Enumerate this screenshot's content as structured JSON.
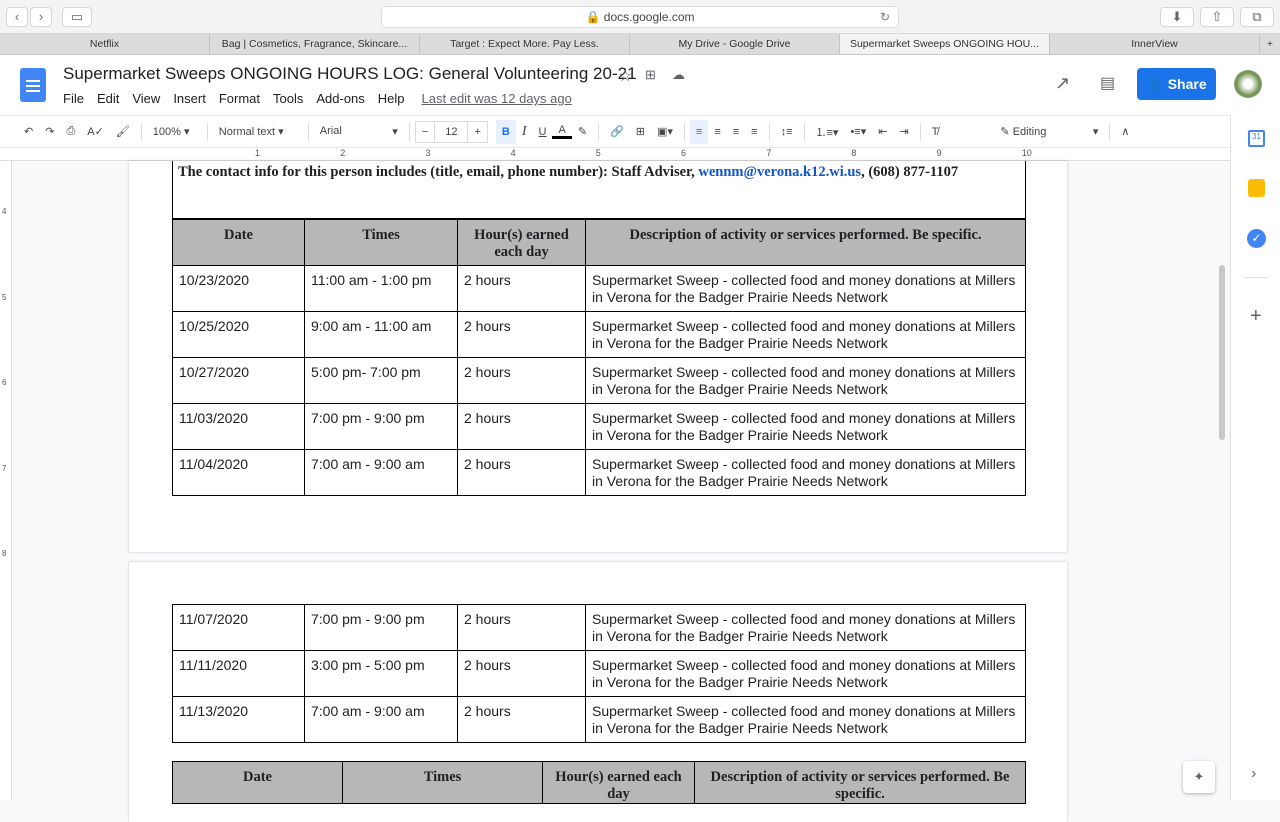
{
  "browser": {
    "url": "docs.google.com",
    "tabs": [
      "Netflix",
      "Bag | Cosmetics, Fragrance, Skincare...",
      "Target : Expect More. Pay Less.",
      "My Drive - Google Drive",
      "Supermarket Sweeps ONGOING HOU...",
      "InnerView"
    ],
    "active_tab": 4
  },
  "doc": {
    "title": "Supermarket Sweeps ONGOING HOURS LOG: General Volunteering 20-21",
    "menu": [
      "File",
      "Edit",
      "View",
      "Insert",
      "Format",
      "Tools",
      "Add-ons",
      "Help"
    ],
    "last_edit": "Last edit was 12 days ago",
    "share": "Share"
  },
  "toolbar": {
    "zoom": "100%",
    "style": "Normal text",
    "font": "Arial",
    "size": "12",
    "mode": "Editing"
  },
  "ruler": [
    "1",
    "2",
    "3",
    "4",
    "5",
    "6",
    "7",
    "8",
    "9",
    "10"
  ],
  "vruler": [
    "4",
    "5",
    "6",
    "7",
    "8"
  ],
  "contact": {
    "prefix": "The contact info for this person includes (title, email, phone number):  Staff Adviser, ",
    "email": "wennm@verona.k12.wi.us",
    "suffix": ", (608) 877-1107"
  },
  "headers": [
    "Date",
    "Times",
    "Hour(s) earned each day",
    "Description of activity or services performed. Be specific."
  ],
  "rows_page1": [
    [
      "10/23/2020",
      "11:00 am - 1:00 pm",
      "2 hours",
      "Supermarket Sweep - collected food and money donations at Millers in Verona for the Badger Prairie Needs Network"
    ],
    [
      "10/25/2020",
      "9:00 am - 11:00 am",
      "2 hours",
      "Supermarket Sweep - collected food and money donations at Millers in Verona for the Badger Prairie Needs Network"
    ],
    [
      "10/27/2020",
      "5:00 pm- 7:00 pm",
      "2 hours",
      "Supermarket Sweep - collected food and money donations at Millers in Verona for the Badger Prairie Needs Network"
    ],
    [
      "11/03/2020",
      "7:00 pm - 9:00 pm",
      "2 hours",
      "Supermarket Sweep - collected food and money donations at Millers in Verona for the Badger Prairie Needs Network"
    ],
    [
      "11/04/2020",
      "7:00 am - 9:00 am",
      "2 hours",
      "Supermarket Sweep - collected food and money donations at Millers in Verona for the Badger Prairie Needs Network"
    ]
  ],
  "rows_page2": [
    [
      "11/07/2020",
      "7:00 pm - 9:00 pm",
      "2 hours",
      "Supermarket Sweep - collected food and money donations at Millers in Verona for the Badger Prairie Needs Network"
    ],
    [
      "11/11/2020",
      "3:00 pm - 5:00 pm",
      "2 hours",
      "Supermarket Sweep - collected food and money donations at Millers in Verona for the Badger Prairie Needs Network"
    ],
    [
      "11/13/2020",
      "7:00 am - 9:00 am",
      "2 hours",
      "Supermarket Sweep - collected food and money donations at Millers in Verona for the Badger Prairie Needs Network"
    ]
  ],
  "colors": {
    "share": "#1a73e8",
    "header_cell": "#b7b7b7",
    "link": "#1155cc"
  }
}
